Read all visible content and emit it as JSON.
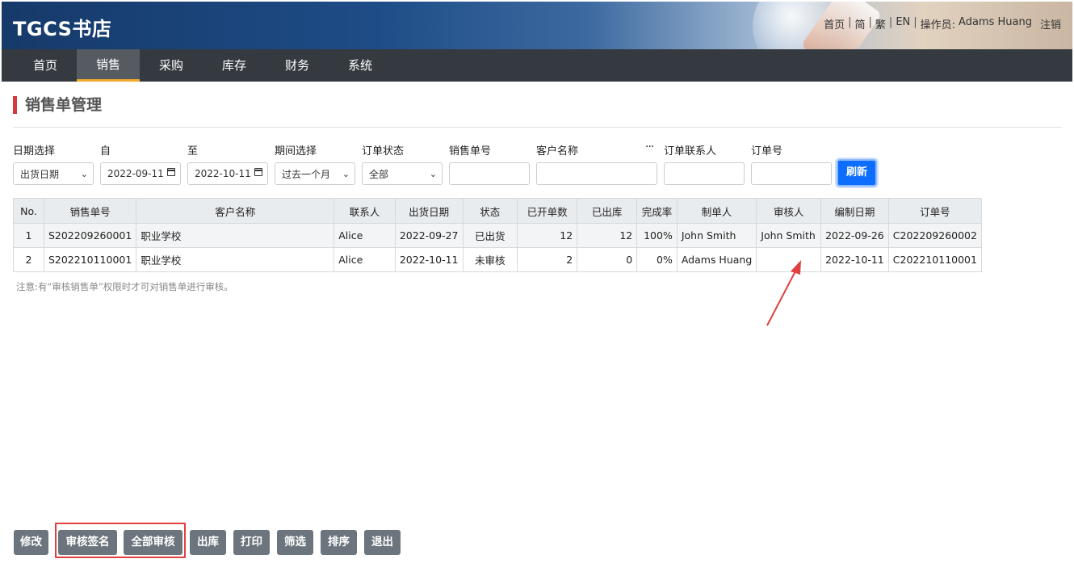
{
  "header": {
    "brand": "TGCS书店",
    "links": {
      "home": "首页",
      "simplified": "简",
      "traditional": "繁",
      "english": "EN",
      "operator_label": "操作员:",
      "operator_name": "Adams Huang",
      "logout": "注销"
    }
  },
  "nav": [
    "首页",
    "销售",
    "采购",
    "库存",
    "财务",
    "系统"
  ],
  "nav_active": "销售",
  "page_title": "销售单管理",
  "filters": {
    "date_select_label": "日期选择",
    "date_select_value": "出货日期",
    "from_label": "自",
    "from_value": "2022-09-11",
    "to_label": "至",
    "to_value": "2022-10-11",
    "period_label": "期间选择",
    "period_value": "过去一个月",
    "status_label": "订单状态",
    "status_value": "全部",
    "sales_no_label": "销售单号",
    "sales_no_value": "",
    "customer_label": "客户名称",
    "customer_value": "",
    "more": "···",
    "contact_label": "订单联系人",
    "contact_value": "",
    "order_no_label": "订单号",
    "order_no_value": "",
    "refresh": "刷新"
  },
  "table": {
    "columns": [
      "No.",
      "销售单号",
      "客户名称",
      "联系人",
      "出货日期",
      "状态",
      "已开单数",
      "已出库",
      "完成率",
      "制单人",
      "审核人",
      "编制日期",
      "订单号"
    ],
    "rows": [
      [
        "1",
        "S202209260001",
        "职业学校",
        "Alice",
        "2022-09-27",
        "已出货",
        "12",
        "12",
        "100%",
        "John Smith",
        "John Smith",
        "2022-09-26",
        "C202209260002"
      ],
      [
        "2",
        "S202210110001",
        "职业学校",
        "Alice",
        "2022-10-11",
        "未审核",
        "2",
        "0",
        "0%",
        "Adams Huang",
        "",
        "2022-10-11",
        "C202210110001"
      ]
    ]
  },
  "note": "注意:有“审核销售单”权限时才可对销售单进行审核。",
  "toolbar": {
    "edit": "修改",
    "review_sign": "审核签名",
    "review_all": "全部审核",
    "outbound": "出库",
    "print": "打印",
    "filter": "筛选",
    "sort": "排序",
    "exit": "退出"
  },
  "colors": {
    "nav_bg": "#353a40",
    "nav_active_underline": "#f0a92a",
    "title_accent": "#d43a3a",
    "primary": "#0d6efd",
    "button_gray": "#6c757d",
    "annotation_red": "#e0403f"
  }
}
